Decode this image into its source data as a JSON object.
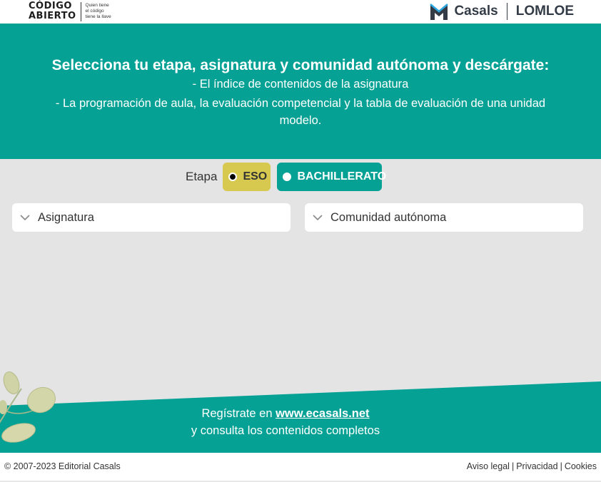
{
  "header": {
    "codigo_logo": {
      "line1": "CÓDIGO",
      "line2": "ABIERTO",
      "tag1": "Quien tiene",
      "tag2": "el código",
      "tag3": "tiene la llave"
    },
    "brand": "Casals",
    "program": "LOMLOE"
  },
  "hero": {
    "title": "Selecciona tu etapa, asignatura y comunidad autónoma y descárgate:",
    "line1": "- El índice de contenidos de la asignatura",
    "line2": "- La programación de aula, la evaluación competencial y la tabla de evaluación de una unidad modelo."
  },
  "filters": {
    "etapa_label": "Etapa",
    "options": [
      {
        "label": "ESO",
        "selected": true
      },
      {
        "label": "BACHILLERATO",
        "selected": false
      }
    ],
    "asignatura_placeholder": "Asignatura",
    "comunidad_placeholder": "Comunidad autónoma"
  },
  "promo": {
    "prefix": "Regístrate en ",
    "link": "www.ecasals.net",
    "line2": "y consulta los contenidos completos"
  },
  "footer": {
    "copyright": "© 2007-2023 Editorial Casals",
    "links": [
      "Aviso legal",
      "Privacidad",
      "Cookies"
    ]
  },
  "colors": {
    "teal": "#05a195",
    "eso_yellow": "#d7c94f",
    "gray_bg": "#e4e4e4"
  },
  "icons": [
    "casals-logo-icon",
    "chevron-down-icon",
    "leaves-decoration-icon"
  ]
}
